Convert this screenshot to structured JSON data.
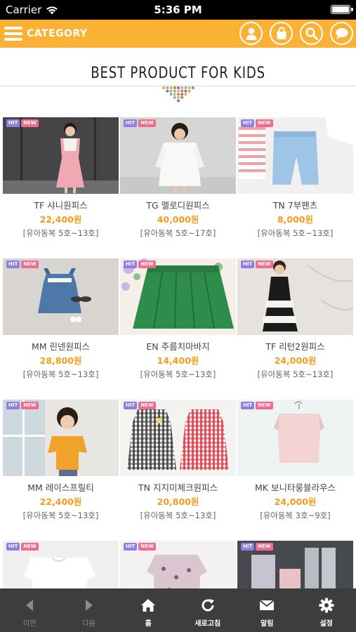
{
  "status_bar": {
    "carrier": "Carrier",
    "time": "5:36 PM"
  },
  "header": {
    "category_label": "CATEGORY",
    "brand_color": "#f9b233",
    "icons": [
      "user-icon",
      "shopping-bag-icon",
      "search-icon",
      "chat-icon"
    ]
  },
  "section_title": "BEST PRODUCT FOR KIDS",
  "badges": {
    "hit": "HIT",
    "new": "NEW"
  },
  "products": [
    {
      "name": "TF 샤니원피스",
      "price": "22,400원",
      "size": "[유아동복 5호~13호]"
    },
    {
      "name": "TG 멜로디원피스",
      "price": "40,000원",
      "size": "[유아동복 5호~17호]"
    },
    {
      "name": "TN 7부팬츠",
      "price": "8,000원",
      "size": "[유아동복 5호~13호]"
    },
    {
      "name": "MM 린넨원피스",
      "price": "28,800원",
      "size": "[유아동복 5호~13호]"
    },
    {
      "name": "EN 주름치마바지",
      "price": "14,400원",
      "size": "[유아동복 5호~13호]"
    },
    {
      "name": "TF 리턴2원피스",
      "price": "24,000원",
      "size": "[유아동복 5호~13호]"
    },
    {
      "name": "MM 레이스프릴티",
      "price": "22,400원",
      "size": "[유아동복 5호~13호]"
    },
    {
      "name": "TN 지지미체크원피스",
      "price": "20,800원",
      "size": "[유아동복 5호~13호]"
    },
    {
      "name": "MK 보니타룽블라우스",
      "price": "24,000원",
      "size": "[유아동복 3호~9호]"
    },
    {
      "name": "",
      "price": "",
      "size": ""
    },
    {
      "name": "",
      "price": "",
      "size": ""
    },
    {
      "name": "",
      "price": "",
      "size": ""
    }
  ],
  "toolbar": {
    "back": "이전",
    "forward": "다음",
    "home": "홈",
    "refresh": "새로고침",
    "notifications": "알림",
    "settings": "설정"
  }
}
